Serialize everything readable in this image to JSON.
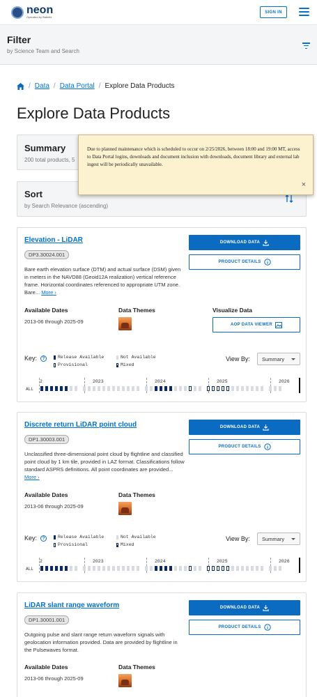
{
  "header": {
    "logo_text": "neon",
    "logo_sub": "Operated by Battelle",
    "signin_label": "SIGN IN"
  },
  "filter": {
    "title": "Filter",
    "subtitle": "by Science Team and Search"
  },
  "breadcrumb": {
    "items": [
      "Data",
      "Data Portal",
      "Explore Data Products"
    ]
  },
  "page_title": "Explore Data Products",
  "summary": {
    "title": "Summary",
    "subtitle": "200 total products, 5"
  },
  "sort": {
    "title": "Sort",
    "subtitle": "by Search Relevance (ascending)"
  },
  "notice": {
    "text": "Due to planned maintenance which is scheduled to occur on 2/25/2026, between 18:00 and 19:00 MT, access to Data Portal logins, downloads and document inclusion with downloads, document library and external lab ingest will be periodically unavailable.",
    "close": "×"
  },
  "labels": {
    "download": "DOWNLOAD DATA",
    "details": "PRODUCT DETAILS",
    "aop_viewer": "AOP DATA VIEWER",
    "available_dates": "Available Dates",
    "data_themes": "Data Themes",
    "visualize": "Visualize Data",
    "key": "Key:",
    "release_available": "Release Available",
    "provisional": "Provisional",
    "not_available": "Not Available",
    "mixed": "Mixed",
    "view_by": "View By:",
    "view_by_value": "Summary",
    "more": "More",
    "all": "ALL"
  },
  "timeline_years": [
    "2023",
    "2024",
    "2025",
    "2026"
  ],
  "timeline_start": "2",
  "products": [
    {
      "title": "Elevation - LiDAR",
      "code": "DP3.30024.001",
      "description": "Bare earth elevation surface (DTM) and actual surface (DSM) given in meters in the NAVD88 (Geoid12A realization) vertical reference frame. Horizontal coordinates referenced to appropriate UTM zone. Bare...",
      "dates": "2013-06 through 2025-09",
      "theme": "landuse-icon"
    },
    {
      "title": "Discrete return LiDAR point cloud",
      "code": "DP1.30003.001",
      "description": "Unclassified three-dimensional point cloud by flightline and classified point cloud by 1 km tile, provided in LAZ format. Classifications follow standard ASPRS definitions. All point coordinates are provided...",
      "dates": "2013-06 through 2025-09",
      "theme": "landuse-icon"
    },
    {
      "title": "LiDAR slant range waveform",
      "code": "DP1.30001.001",
      "description": "Outgoing pulse and slant range return waveform signals with geolocation information provided. Data are provided by flightline in the Pulsewaves format.",
      "dates": "2013-06 through 2025-09",
      "theme": "landuse-icon"
    }
  ]
}
